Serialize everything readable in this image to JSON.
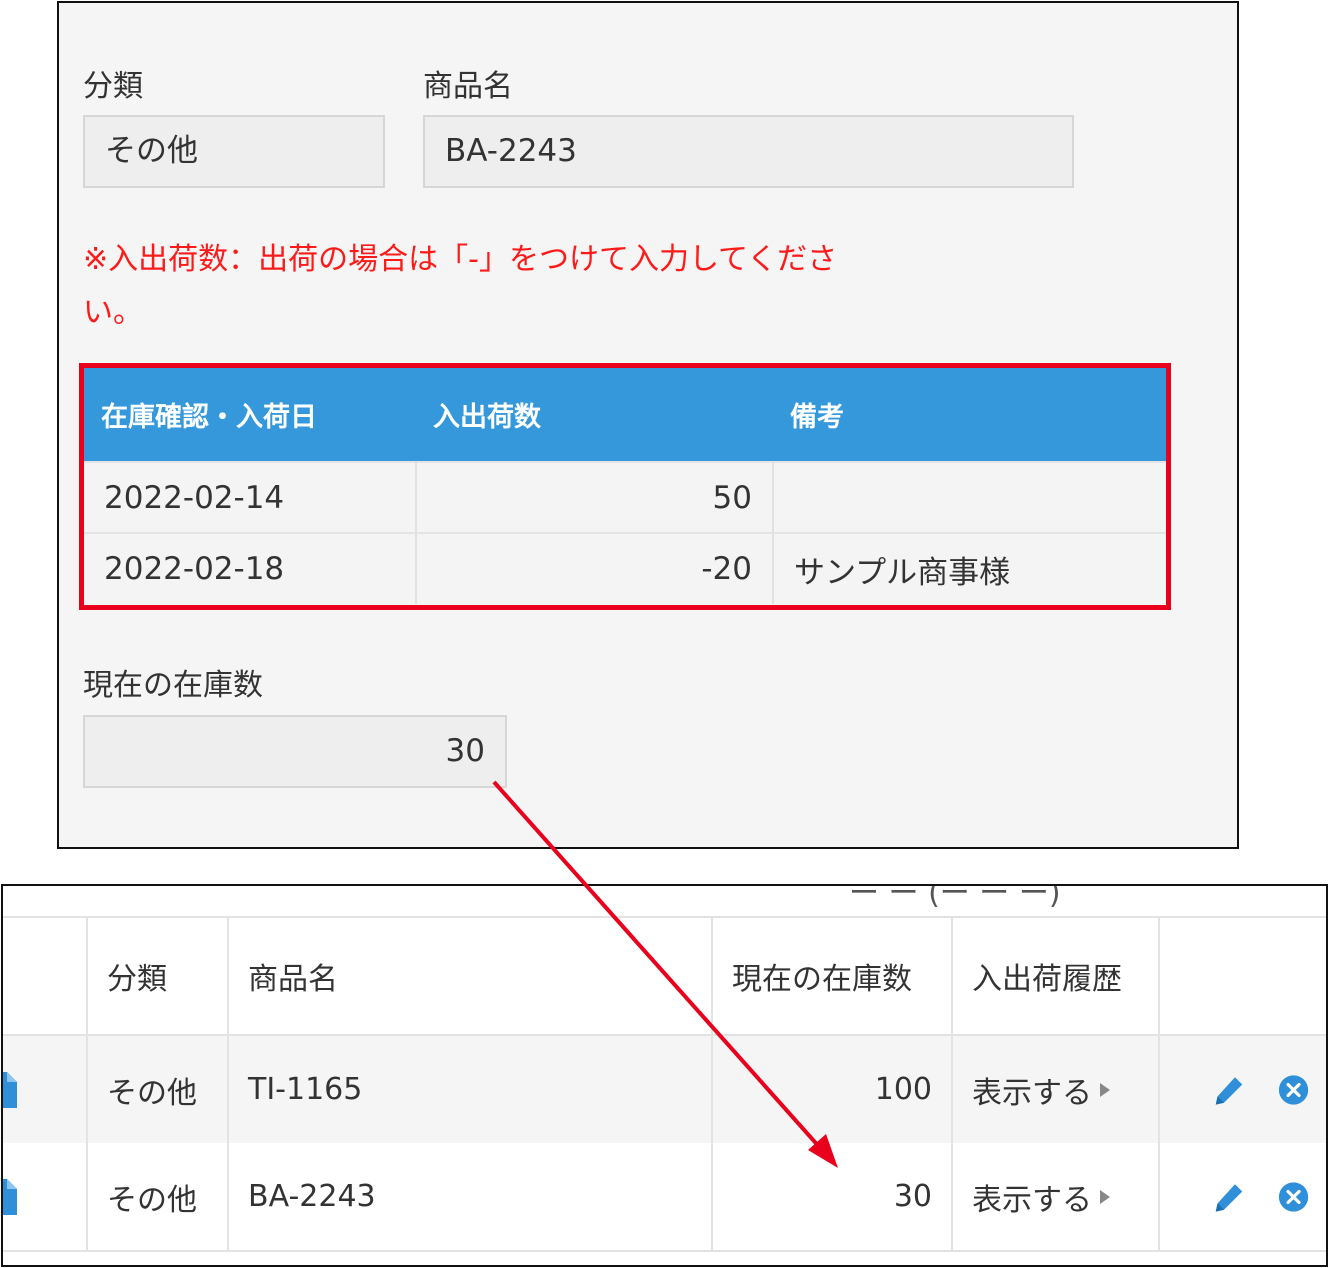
{
  "record": {
    "category": {
      "label": "分類",
      "value": "その他"
    },
    "product": {
      "label": "商品名",
      "value": "BA-2243"
    },
    "note_line1": "※入出荷数：出荷の場合は「-」をつけて入力してくださ",
    "note_line2": "い。",
    "history": {
      "headers": [
        "在庫確認・入荷日",
        "入出荷数",
        "備考"
      ],
      "rows": [
        {
          "date": "2022-02-14",
          "qty": "50",
          "remark": ""
        },
        {
          "date": "2022-02-18",
          "qty": "-20",
          "remark": "サンプル商事様"
        }
      ]
    },
    "stock": {
      "label": "現在の在庫数",
      "value": "30"
    }
  },
  "list": {
    "cutoff_text": "ー ー (ー ー ー)",
    "headers": [
      "",
      "分類",
      "商品名",
      "現在の在庫数",
      "入出荷履歴",
      ""
    ],
    "rows": [
      {
        "category": "その他",
        "product": "TI-1165",
        "stock": "100",
        "link": "表示する"
      },
      {
        "category": "その他",
        "product": "BA-2243",
        "stock": "30",
        "link": "表示する"
      }
    ]
  },
  "colors": {
    "header_blue": "#3498db",
    "highlight_red": "#e8001c",
    "note_red": "#ff1a1a",
    "icon_blue": "#2f8fd8"
  },
  "icons": [
    "document-icon",
    "pencil-icon",
    "close-circle-icon",
    "caret-right-icon"
  ]
}
